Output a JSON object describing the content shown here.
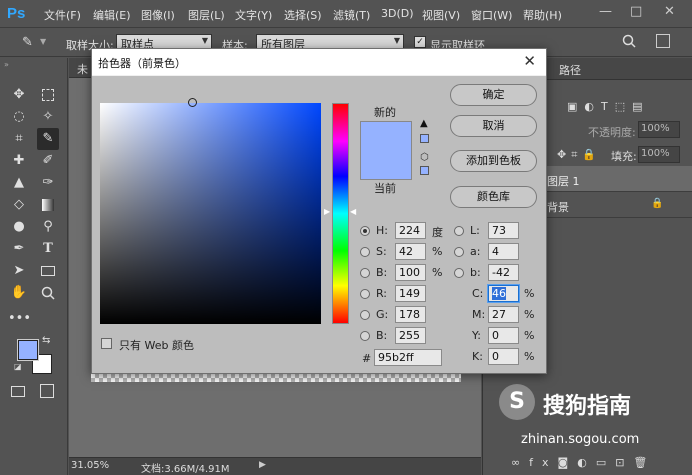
{
  "app": {
    "logo": "Ps"
  },
  "menu": [
    "文件(F)",
    "编辑(E)",
    "图像(I)",
    "图层(L)",
    "文字(Y)",
    "选择(S)",
    "滤镜(T)",
    "3D(D)",
    "视图(V)",
    "窗口(W)",
    "帮助(H)"
  ],
  "window_controls": {
    "minimize": "—",
    "maximize": "□",
    "close": "✕"
  },
  "options": {
    "sample_size_label": "取样大小:",
    "sample_size_value": "取样点",
    "sample_label": "样本:",
    "sample_value": "所有图层",
    "show_ring_label": "显示取样环"
  },
  "document": {
    "tab_label": "未",
    "zoom": "31.05%",
    "doc_info": "文档:3.66M/4.91M"
  },
  "right_panel": {
    "tab_paths": "路径",
    "opacity_label": "不透明度:",
    "opacity_value": "100%",
    "fill_label": "填充:",
    "fill_value": "100%",
    "layer1_name": "图层 1",
    "background_name": "背景",
    "watermark_brand": "搜狗指南",
    "watermark_url": "zhinan.sogou.com"
  },
  "dialog": {
    "title": "拾色器（前景色）",
    "close_glyph": "✕",
    "new_label": "新的",
    "current_label": "当前",
    "buttons": {
      "ok": "确定",
      "cancel": "取消",
      "add_swatch": "添加到色板",
      "color_libraries": "颜色库"
    },
    "web_only_label": "只有 Web 颜色",
    "hsb": {
      "h": "224",
      "h_unit": "度",
      "s": "42",
      "s_unit": "%",
      "b": "100",
      "b_unit": "%"
    },
    "lab": {
      "l": "73",
      "a": "4",
      "b": "-42"
    },
    "rgb": {
      "r": "149",
      "g": "178",
      "b": "255"
    },
    "cmyk": {
      "c": "46",
      "m": "27",
      "y": "0",
      "k": "0",
      "unit": "%"
    },
    "hex": "95b2ff",
    "labels": {
      "H": "H:",
      "S": "S:",
      "B": "B:",
      "L": "L:",
      "a": "a:",
      "b": "b:",
      "R": "R:",
      "G": "G:",
      "Bb": "B:",
      "C": "C:",
      "M": "M:",
      "Y": "Y:",
      "K": "K:",
      "hash": "#"
    }
  },
  "colors": {
    "new_color": "#95b2ff",
    "current_color": "#95b2ff",
    "field_hue": "#0047ff",
    "foreground": "#95b2ff",
    "background": "#ffffff"
  },
  "icons": [
    "eyedropper-icon",
    "search-icon",
    "move-icon",
    "marquee-icon",
    "lasso-icon",
    "magic-wand-icon",
    "crop-icon",
    "brush-icon",
    "eraser-icon",
    "gradient-icon",
    "pen-icon",
    "type-icon",
    "hand-icon",
    "zoom-icon",
    "warning-icon",
    "cube-icon",
    "lock-icon"
  ]
}
